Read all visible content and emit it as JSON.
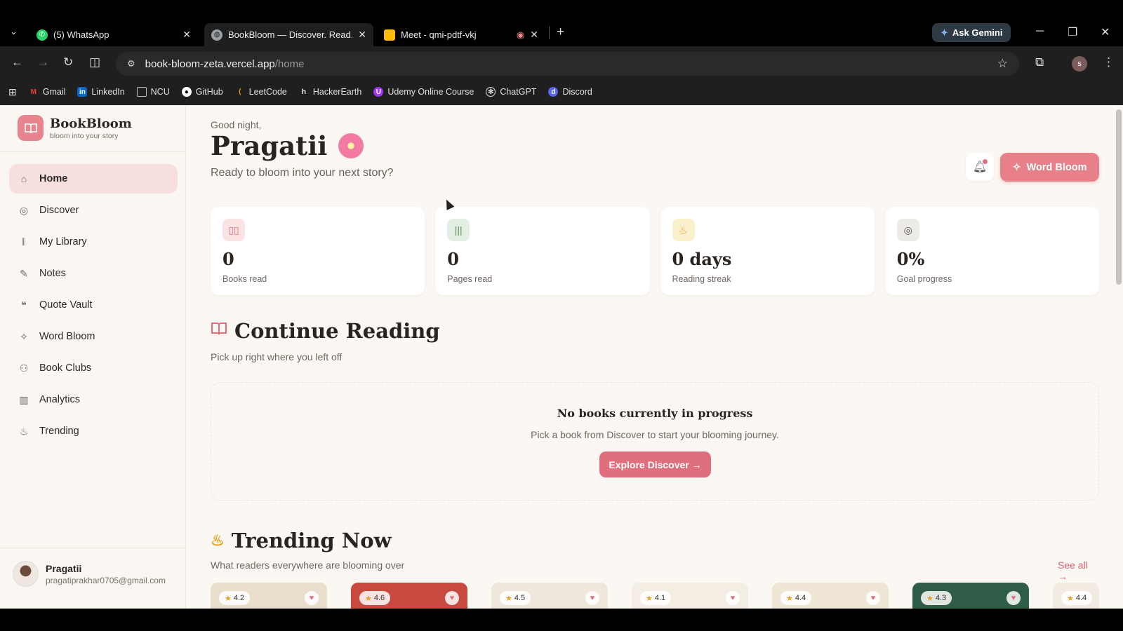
{
  "browser": {
    "tabs": [
      {
        "title": "(5) WhatsApp",
        "icon": "whatsapp-icon",
        "color": "#25d366"
      },
      {
        "title": "BookBloom — Discover. Read. B",
        "icon": "globe-icon",
        "color": "#9aa0a6"
      },
      {
        "title": "Meet - qmi-pdtf-vkj",
        "icon": "meet-icon",
        "color": "#fbbc04"
      }
    ],
    "gemini_label": "Ask Gemini",
    "url_host": "book-bloom-zeta.vercel.app",
    "url_path": "/home",
    "profile_initial": "s",
    "bookmarks": [
      {
        "label": "Gmail",
        "icon": "gmail-icon",
        "color": "#ea4335"
      },
      {
        "label": "LinkedIn",
        "icon": "linkedin-icon",
        "color": "#0a66c2"
      },
      {
        "label": "NCU",
        "icon": "folder-icon",
        "color": "#bbbbbb"
      },
      {
        "label": "GitHub",
        "icon": "github-icon",
        "color": "#ffffff"
      },
      {
        "label": "LeetCode",
        "icon": "leetcode-icon",
        "color": "#ffa116"
      },
      {
        "label": "HackerEarth",
        "icon": "hackerearth-icon",
        "color": "#ffffff"
      },
      {
        "label": "Udemy Online Course",
        "icon": "udemy-icon",
        "color": "#a435f0"
      },
      {
        "label": "ChatGPT",
        "icon": "chatgpt-icon",
        "color": "#ffffff"
      },
      {
        "label": "Discord",
        "icon": "discord-icon",
        "color": "#5865f2"
      }
    ]
  },
  "app": {
    "brand_name": "BookBloom",
    "brand_tagline": "bloom into your story",
    "accent": "#e78089",
    "nav": [
      {
        "label": "Home",
        "icon": "home-icon",
        "active": true
      },
      {
        "label": "Discover",
        "icon": "compass-icon"
      },
      {
        "label": "My Library",
        "icon": "library-icon"
      },
      {
        "label": "Notes",
        "icon": "notes-icon"
      },
      {
        "label": "Quote Vault",
        "icon": "quote-icon"
      },
      {
        "label": "Word Bloom",
        "icon": "sparkle-icon"
      },
      {
        "label": "Book Clubs",
        "icon": "users-icon"
      },
      {
        "label": "Analytics",
        "icon": "chart-icon"
      },
      {
        "label": "Trending",
        "icon": "flame-icon"
      }
    ],
    "user": {
      "name": "Pragatii",
      "email": "pragatiprakhar0705@gmail.com"
    }
  },
  "header": {
    "greeting": "Good night,",
    "name": "Pragatii",
    "subtitle": "Ready to bloom into your next story?",
    "word_bloom_button": "Word Bloom"
  },
  "stats": [
    {
      "value": "0",
      "label": "Books read",
      "icon": "book-icon",
      "bg": "#fbe3e4",
      "fg": "#e06f7d"
    },
    {
      "value": "0",
      "label": "Pages read",
      "icon": "library-icon",
      "bg": "#e3efe2",
      "fg": "#5d8c5a"
    },
    {
      "value": "0 days",
      "label": "Reading streak",
      "icon": "flame-icon",
      "bg": "#fbf0cc",
      "fg": "#d99a1b"
    },
    {
      "value": "0%",
      "label": "Goal progress",
      "icon": "target-icon",
      "bg": "#ecebe8",
      "fg": "#5b5551"
    }
  ],
  "continue_reading": {
    "title": "Continue Reading",
    "subtitle": "Pick up right where you left off",
    "empty_title": "No books currently in progress",
    "empty_subtitle": "Pick a book from Discover to start your blooming journey.",
    "button": "Explore Discover →"
  },
  "trending": {
    "title": "Trending Now",
    "subtitle": "What readers everywhere are blooming over",
    "see_all": "See all →",
    "cards": [
      {
        "rating": "4.2",
        "color": "#eadfcd"
      },
      {
        "rating": "4.6",
        "color": "#c84a3e"
      },
      {
        "rating": "4.5",
        "color": "#efe7dc"
      },
      {
        "rating": "4.1",
        "color": "#f3ede4"
      },
      {
        "rating": "4.4",
        "color": "#efe6d6"
      },
      {
        "rating": "4.3",
        "color": "#2f5d47"
      },
      {
        "rating": "4.4",
        "color": "#f1ebe2"
      }
    ]
  }
}
